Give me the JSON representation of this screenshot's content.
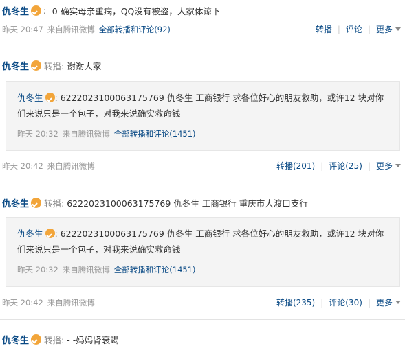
{
  "posts": [
    {
      "author": "仇冬生",
      "text": "-0-确实母亲重病，QQ没有被盗，大家体谅下",
      "time": "昨天  20:47",
      "source": "来自腾讯微博",
      "all_label": "全部转播和评论(92)",
      "actions": {
        "retweet": "转播",
        "comment": "评论",
        "more": "更多"
      }
    },
    {
      "author": "仇冬生",
      "rt_label": "转播:",
      "text": "谢谢大家",
      "quote": {
        "author": "仇冬生",
        "text": "6222023100063175769 仇冬生  工商银行  求各位好心的朋友救助，或许12 块对你们来说只是一个包子，对我来说确实救命钱",
        "time": "昨天  20:32",
        "source": "来自腾讯微博",
        "all_label": "全部转播和评论(1451)"
      },
      "time": "昨天  20:42",
      "source": "来自腾讯微博",
      "actions": {
        "retweet": "转播(201)",
        "comment": "评论(25)",
        "more": "更多"
      }
    },
    {
      "author": "仇冬生",
      "rt_label": "转播:",
      "text": "6222023100063175769 仇冬生  工商银行  重庆市大渡口支行",
      "quote": {
        "author": "仇冬生",
        "text": "6222023100063175769 仇冬生  工商银行  求各位好心的朋友救助，或许12 块对你们来说只是一个包子，对我来说确实救命钱",
        "time": "昨天  20:32",
        "source": "来自腾讯微博",
        "all_label": "全部转播和评论(1451)"
      },
      "time": "昨天  20:42",
      "source": "来自腾讯微博",
      "actions": {
        "retweet": "转播(235)",
        "comment": "评论(30)",
        "more": "更多"
      }
    },
    {
      "author": "仇冬生",
      "rt_label": "转播:",
      "text": "- -妈妈肾衰竭"
    }
  ],
  "colors": {
    "link": "#0a4a85",
    "meta": "#999999",
    "badge": "#f2a53a",
    "quote_bg": "#f4f4f4"
  }
}
